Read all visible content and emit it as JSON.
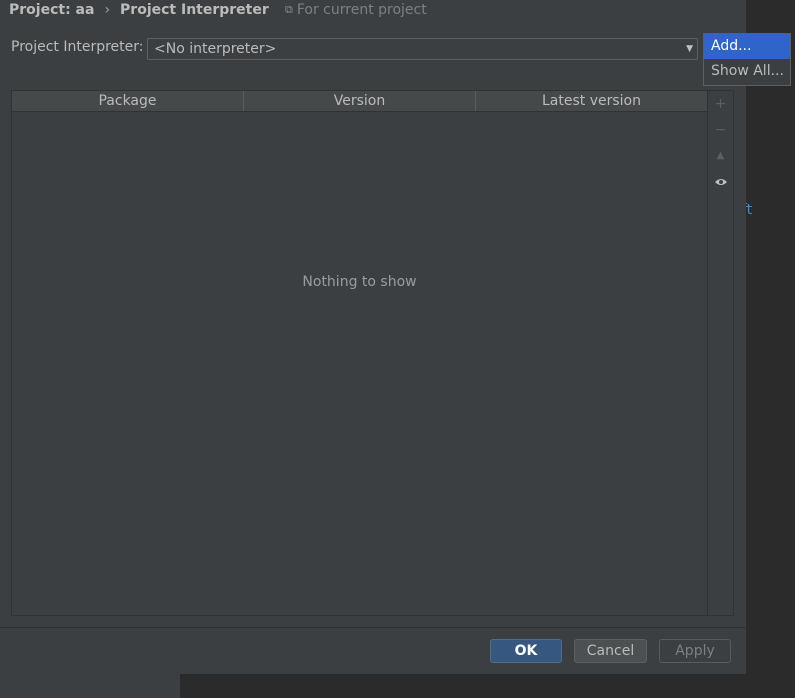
{
  "breadcrumb": {
    "project": "Project: aa",
    "separator": "›",
    "page": "Project Interpreter"
  },
  "scope_hint": {
    "icon": "copy-icon",
    "text": "For current project"
  },
  "interpreter": {
    "label": "Project Interpreter:",
    "value": "<No interpreter>",
    "arrow_icon": "chevron-down-icon"
  },
  "gear_menu": {
    "items": [
      "Add...",
      "Show All..."
    ],
    "selected_index": 0
  },
  "table": {
    "columns": [
      "Package",
      "Version",
      "Latest version"
    ],
    "empty_text": "Nothing to show"
  },
  "side_toolbar": {
    "icons": [
      "plus-icon",
      "minus-icon",
      "upgrade-icon",
      "eye-icon"
    ]
  },
  "buttons": {
    "ok": "OK",
    "cancel": "Cancel",
    "apply": "Apply"
  },
  "background": {
    "link_fragment": "ft"
  },
  "colors": {
    "accent": "#2f65ca",
    "ok_button": "#365880",
    "dialog_bg": "#3c3f41"
  }
}
